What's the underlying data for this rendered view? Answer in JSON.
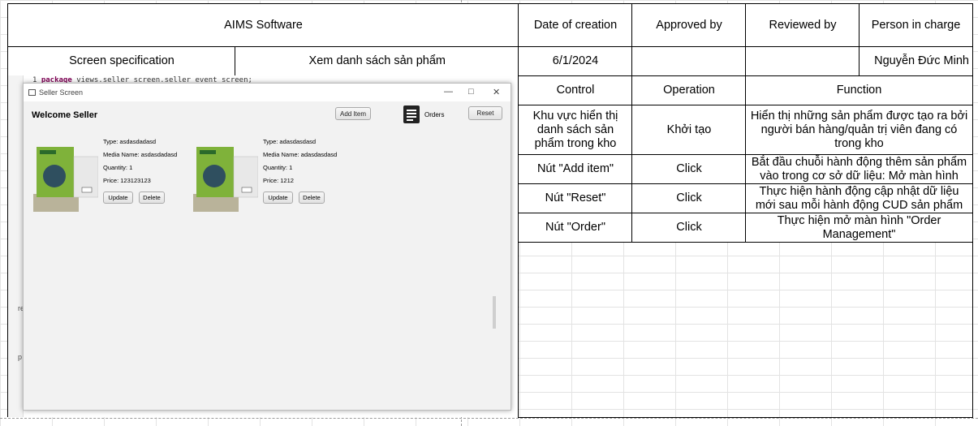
{
  "header": {
    "app_name": "AIMS Software",
    "date_label": "Date of creation",
    "approved_label": "Approved by",
    "reviewed_label": "Reviewed by",
    "person_label": "Person in charge",
    "spec_label": "Screen specification",
    "screen_name": "Xem danh sách sản phẩm",
    "date_value": "6/1/2024",
    "approved_value": "",
    "reviewed_value": "",
    "person_value": "Nguyễn Đức Minh"
  },
  "table": {
    "headers": [
      "Control",
      "Operation",
      "Function"
    ],
    "rows": [
      {
        "control": "Khu vực hiển thị danh sách sản phẩm trong kho",
        "operation": "Khởi tạo",
        "function": "Hiển thị những sản phẩm được tạo ra bởi người bán hàng/quản trị viên đang có trong kho"
      },
      {
        "control": "Nút \"Add item\"",
        "operation": "Click",
        "function": "Bắt đầu chuỗi hành động thêm sản phẩm vào trong cơ sở dữ liệu: Mở màn hình"
      },
      {
        "control": "Nút \"Reset\"",
        "operation": "Click",
        "function": "Thực hiện hành động cập nhật dữ liệu mới sau mỗi hành động CUD sản phẩm"
      },
      {
        "control": "Nút \"Order\"",
        "operation": "Click",
        "function": "Thực hiện mở màn hình \"Order Management\""
      }
    ]
  },
  "ide": {
    "line_no": "1",
    "keyword": "package",
    "code": " views.seller_screen.seller_event_screen;",
    "side_letters": [
      "re",
      "p"
    ]
  },
  "app": {
    "window_title": "Seller Screen",
    "welcome": "Welcome Seller",
    "add_item": "Add Item",
    "orders": "Orders",
    "reset": "Reset",
    "update": "Update",
    "delete": "Delete",
    "products": [
      {
        "type": "Type: asdasdadasd",
        "media": "Media Name: asdasdadasd",
        "qty": "Quantity: 1",
        "price": "Price: 123123123"
      },
      {
        "type": "Type: adasdasdasd",
        "media": "Media Name: adasdasdasd",
        "qty": "Quantity: 1",
        "price": "Price: 1212"
      }
    ],
    "book_cover_text": "Smart Persuasion"
  },
  "colors": {
    "border": "#000000",
    "grid": "#e3e3e3",
    "book_green": "#7fb23a",
    "book_brain": "#2f4f5f",
    "keyword": "#7f0055"
  }
}
